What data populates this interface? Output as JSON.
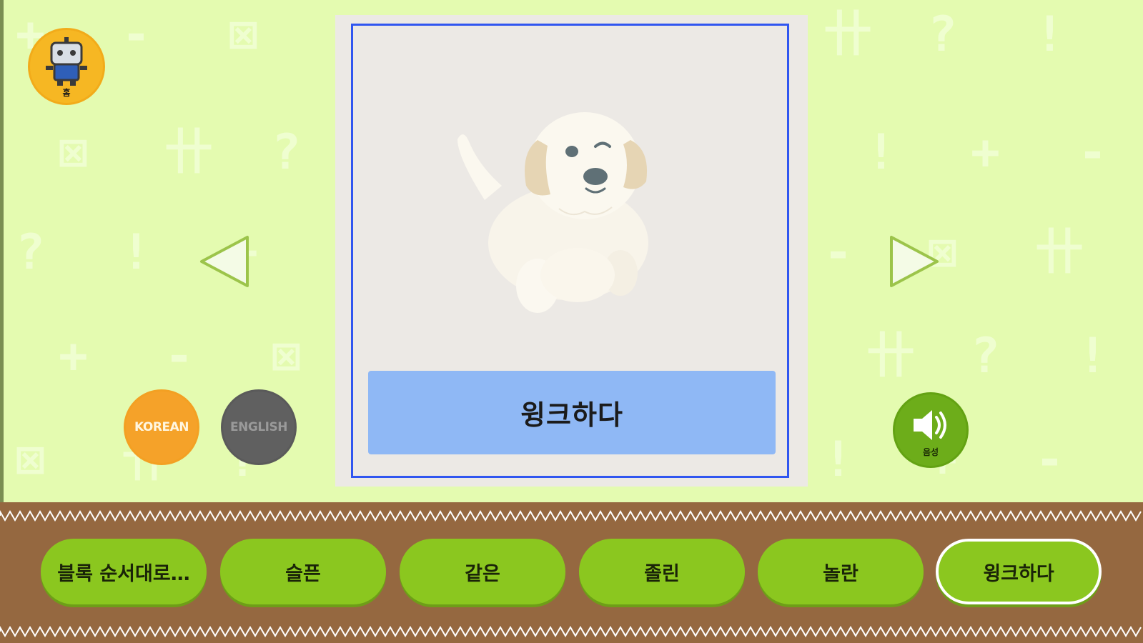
{
  "app": {
    "home_icon": "robot-home-icon",
    "home_label": "홈"
  },
  "navigation": {
    "prev_icon": "left-triangle-arrow-icon",
    "next_icon": "right-triangle-arrow-icon"
  },
  "language": {
    "korean_label": "KOREAN",
    "english_label": "ENGLISH",
    "selected": "KOREAN"
  },
  "card": {
    "image_icon": "winking-puppy-illustration",
    "word": "윙크하다"
  },
  "sound": {
    "icon": "speaker-icon",
    "label": "음성"
  },
  "word_tabs": {
    "items": [
      {
        "label": "블록 순서대로…"
      },
      {
        "label": "슬픈"
      },
      {
        "label": "같은"
      },
      {
        "label": "졸린"
      },
      {
        "label": "놀란"
      },
      {
        "label": "윙크하다"
      }
    ],
    "active_index": 5
  },
  "colors": {
    "background": "#e4fbb0",
    "card_border": "#3056f0",
    "word_banner": "#8fb8f5",
    "tab_green": "#8bc71f",
    "ground": "#956840",
    "korean_button": "#f5a229",
    "english_button": "#606060"
  }
}
